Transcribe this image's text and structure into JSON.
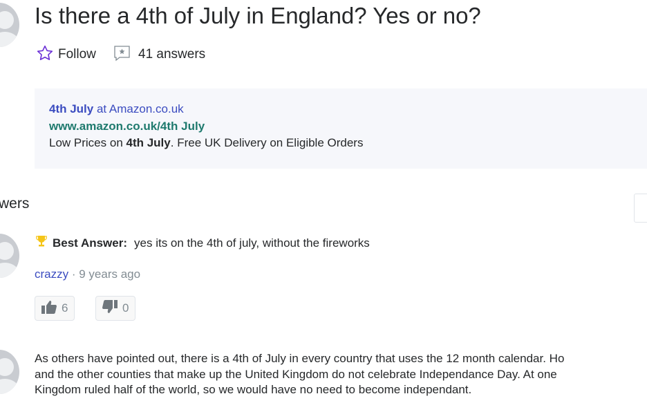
{
  "question": {
    "title": "Is there a 4th of July in England? Yes or no?",
    "follow_label": "Follow",
    "answers_count_label": "41 answers"
  },
  "ad": {
    "title_bold": "4th July",
    "title_rest": " at Amazon.co.uk",
    "url": "www.amazon.co.uk/4th July",
    "desc_prefix": "Low Prices on ",
    "desc_bold": "4th July",
    "desc_suffix": ". Free UK Delivery on Eligible Orders"
  },
  "answers_section": {
    "heading": "wers"
  },
  "best_answer": {
    "label": "Best Answer:",
    "text": "yes its on the 4th of july, without the fireworks",
    "author": "crazzy",
    "separator": " · ",
    "age": "9 years ago",
    "upvotes": "6",
    "downvotes": "0"
  },
  "answer2": {
    "lines": [
      "As others have pointed out, there is a 4th of July in every country that uses the 12 month calendar. Ho",
      "and the other counties that make up the United Kingdom do not celebrate Independance Day. At one",
      "Kingdom ruled half of the world, so we would have no need to become independant."
    ]
  },
  "colors": {
    "link_blue": "#3b4cc0",
    "url_green": "#1f7a6e",
    "ad_background": "#f6f7fb",
    "muted_gray": "#828c93",
    "trophy_gold": "#f5c518",
    "follow_star_purple": "#6b2fd6"
  },
  "icons": {
    "follow": "star-outline-icon",
    "answers": "speech-bubble-star-icon",
    "best_answer": "trophy-icon",
    "upvote": "thumbs-up-icon",
    "downvote": "thumbs-down-icon"
  }
}
